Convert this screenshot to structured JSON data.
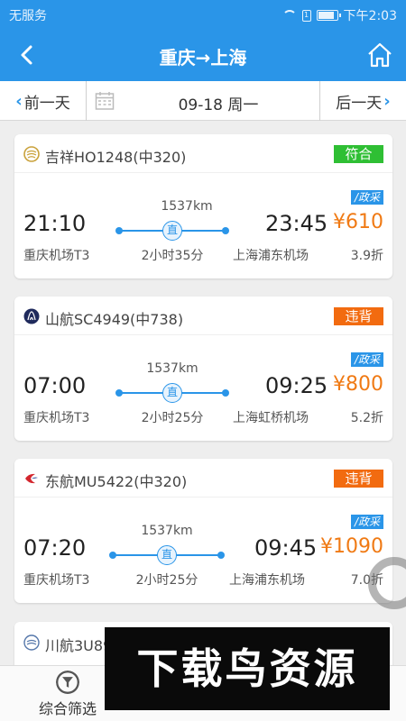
{
  "status_bar": {
    "carrier": "无服务",
    "time": "下午2:03"
  },
  "nav": {
    "title": "重庆→上海"
  },
  "date_bar": {
    "prev_label": "前一天",
    "date": "09-18 周一",
    "next_label": "后一天"
  },
  "flights": [
    {
      "airline": "吉祥HO1248(中320)",
      "badge": "符合",
      "dep_time": "21:10",
      "dep_airport": "重庆机场T3",
      "distance": "1537km",
      "direct": "直",
      "duration": "2小时35分",
      "arr_time": "23:45",
      "arr_airport": "上海浦东机场",
      "policy": "/政采",
      "price": "¥610",
      "discount": "3.9折"
    },
    {
      "airline": "山航SC4949(中738)",
      "badge": "违背",
      "dep_time": "07:00",
      "dep_airport": "重庆机场T3",
      "distance": "1537km",
      "direct": "直",
      "duration": "2小时25分",
      "arr_time": "09:25",
      "arr_airport": "上海虹桥机场",
      "policy": "/政采",
      "price": "¥800",
      "discount": "5.2折"
    },
    {
      "airline": "东航MU5422(中320)",
      "badge": "违背",
      "dep_time": "07:20",
      "dep_airport": "重庆机场T3",
      "distance": "1537km",
      "direct": "直",
      "duration": "2小时25分",
      "arr_time": "09:45",
      "arr_airport": "上海浦东机场",
      "policy": "/政采",
      "price": "¥1090",
      "discount": "7.0折"
    }
  ],
  "partial_flight": {
    "airline": "川航3U89"
  },
  "bottom_bar": {
    "filter_label": "综合筛选"
  },
  "watermark": {
    "text": "下载鸟资源"
  },
  "colors": {
    "primary": "#2a95e8",
    "price": "#f07a14",
    "ok_badge": "#2fbf34",
    "bad_badge": "#f26b10"
  },
  "icons": {
    "back": "chevron-left-icon",
    "home": "home-icon",
    "calendar": "calendar-icon",
    "filter": "filter-icon"
  }
}
